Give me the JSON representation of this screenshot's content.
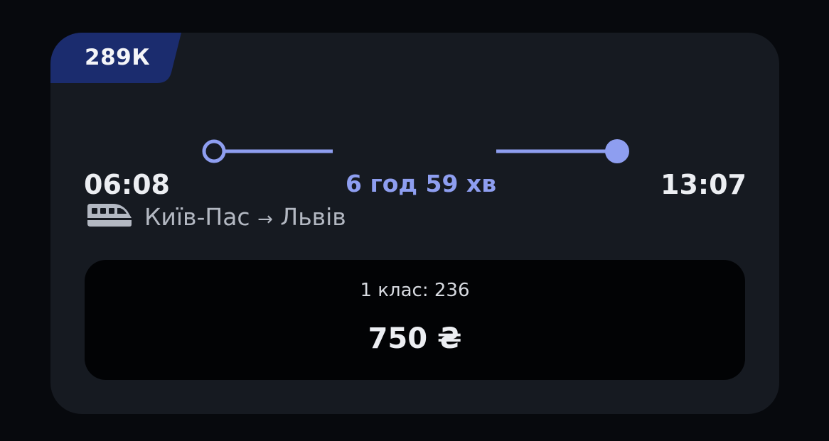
{
  "card": {
    "train_number": "289К",
    "departure_time": "06:08",
    "arrival_time": "13:07",
    "duration": "6 год 59 хв",
    "origin": "Київ-Пас",
    "arrow": "→",
    "destination": "Львів",
    "train_icon": "train-icon",
    "seat_class": "1 клас: 236",
    "price": "750 ₴"
  },
  "colors": {
    "background": "#07090d",
    "card": "#161a21",
    "badge": "#1b2c6e",
    "accent": "#8e9ef0",
    "price_box": "#020305"
  }
}
